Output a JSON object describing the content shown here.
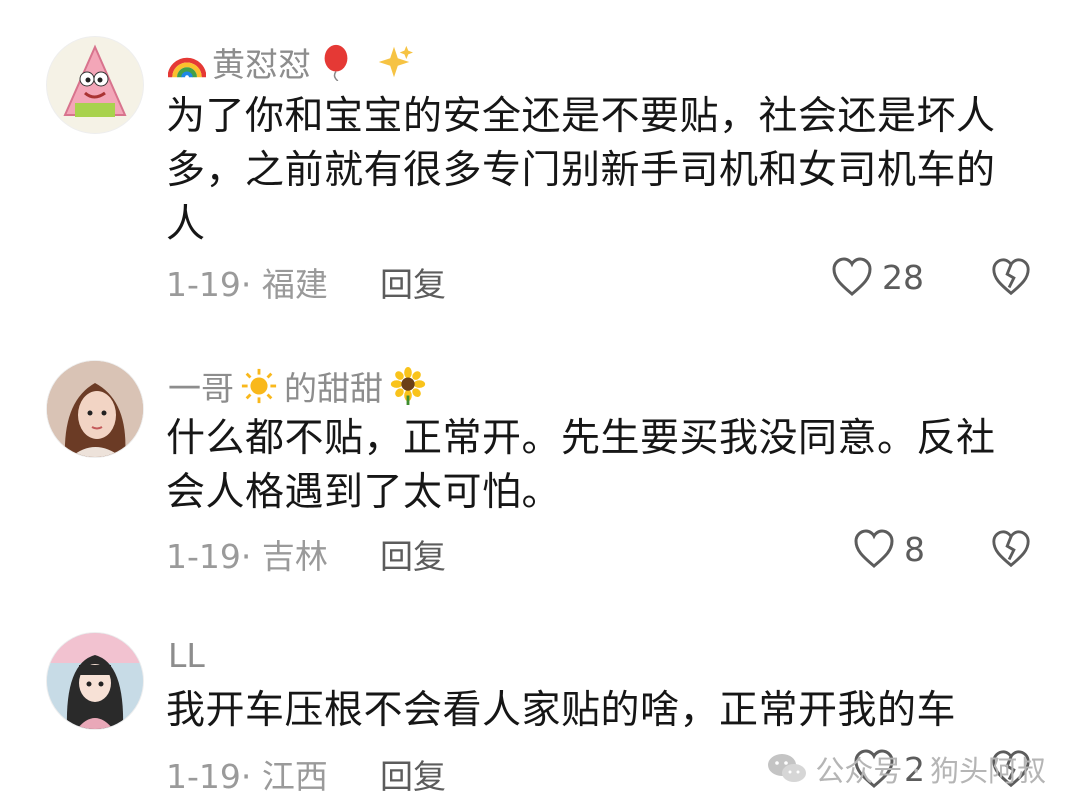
{
  "comments": [
    {
      "username": "黄怼怼",
      "text": "为了你和宝宝的安全还是不要贴，社会还是坏人多，之前就有很多专门别新手司机和女司机车的人",
      "date_location": "1-19· 福建",
      "reply_label": "回复",
      "like_count": "28"
    },
    {
      "username_part1": "一哥",
      "username_part2": "的甜甜",
      "text": "什么都不贴，正常开。先生要买我没同意。反社会人格遇到了太可怕。",
      "date_location": "1-19· 吉林",
      "reply_label": "回复",
      "like_count": "8"
    },
    {
      "username": "LL",
      "text": "我开车压根不会看人家贴的啥，正常开我的车",
      "date_location": "1-19· 江西",
      "reply_label": "回复",
      "like_count": "2"
    }
  ],
  "watermark": "公众号 · 狗头阿叔",
  "icons": {
    "like": "heart-outline-icon",
    "dislike": "broken-heart-icon",
    "watermark": "wechat-icon"
  },
  "colors": {
    "text": "#161616",
    "meta": "#9a9a9a",
    "username": "#8d8d8d"
  }
}
